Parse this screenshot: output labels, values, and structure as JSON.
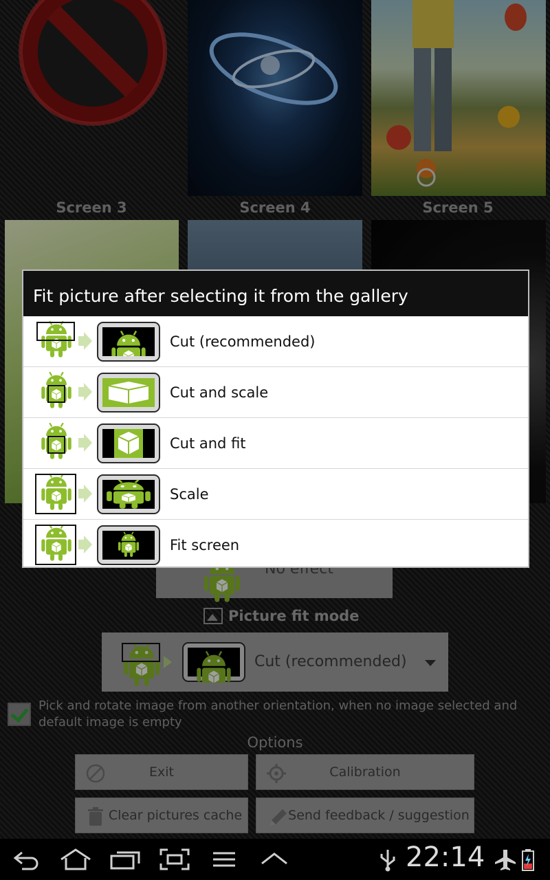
{
  "screens": {
    "labels": [
      "Screen 3",
      "Screen 4",
      "Screen 5"
    ]
  },
  "effect": {
    "value": "No effect"
  },
  "picture_fit_mode": {
    "label": "Picture fit mode",
    "selected": "Cut (recommended)"
  },
  "pick_rotate": {
    "checked": true,
    "label": "Pick and rotate image from another orientation, when no image selected and default image is empty"
  },
  "options": {
    "label": "Options",
    "exit": "Exit",
    "calibration": "Calibration",
    "clear_cache": "Clear pictures cache",
    "feedback": "Send feedback / suggestion"
  },
  "dialog": {
    "title": "Fit picture after selecting it from the gallery",
    "items": [
      {
        "label": "Cut (recommended)"
      },
      {
        "label": "Cut and scale"
      },
      {
        "label": "Cut and fit"
      },
      {
        "label": "Scale"
      },
      {
        "label": "Fit screen"
      }
    ]
  },
  "system_bar": {
    "time": "22:14",
    "icons": [
      "back-icon",
      "home-icon",
      "recent-apps-icon",
      "screenshot-icon",
      "menu-icon",
      "up-icon",
      "usb-icon",
      "airplane-icon",
      "battery-icon"
    ]
  },
  "colors": {
    "accent_green": "#8dbd2c",
    "check_green": "#2fa83a",
    "dialog_title_bg": "#111111"
  }
}
